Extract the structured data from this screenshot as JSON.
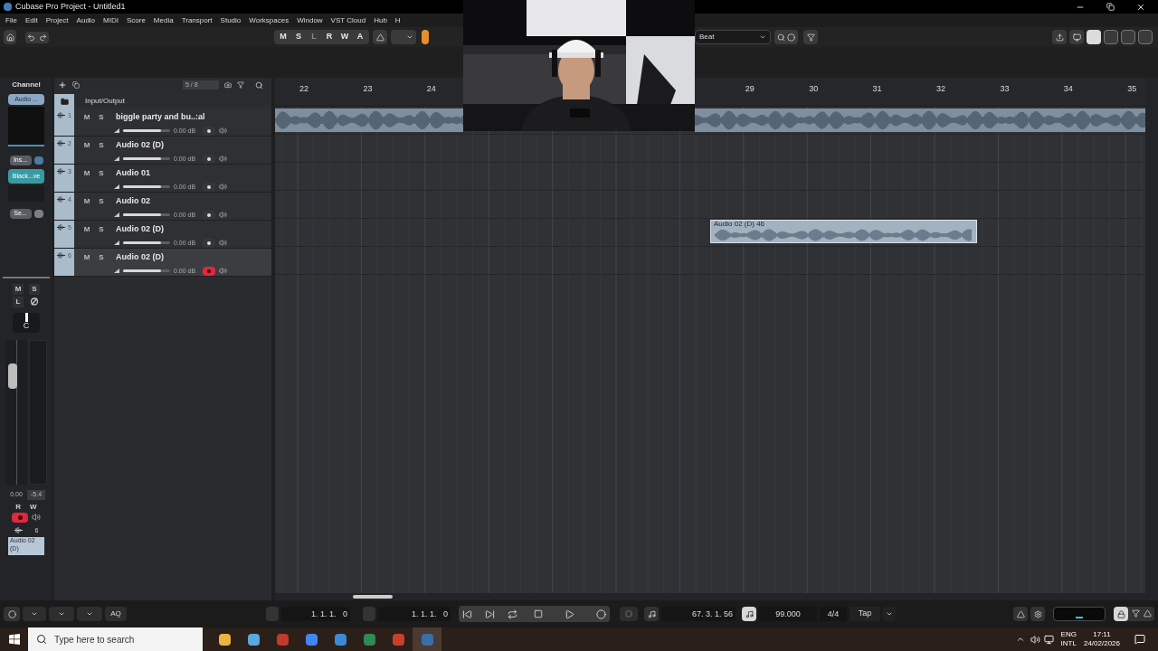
{
  "window": {
    "title": "Cubase Pro Project - Untitled1"
  },
  "menu": [
    "File",
    "Edit",
    "Project",
    "Audio",
    "MIDI",
    "Score",
    "Media",
    "Transport",
    "Studio",
    "Workspaces",
    "Window",
    "VST Cloud",
    "Hub",
    "H"
  ],
  "toolbar": {
    "automation_buttons": [
      {
        "label": "M",
        "disabled": false
      },
      {
        "label": "S",
        "disabled": false
      },
      {
        "label": "L",
        "disabled": true
      },
      {
        "label": "R",
        "disabled": false
      },
      {
        "label": "W",
        "disabled": false
      },
      {
        "label": "A",
        "disabled": false
      }
    ],
    "snap_type": "Beat"
  },
  "inspector": {
    "title": "Channel",
    "track_button": "Audio ...",
    "inserts_button": "Ins...",
    "insert_slot": "Black...ve",
    "sends_button": "Se...",
    "mute": "M",
    "solo": "S",
    "listen": "L",
    "pan": "C",
    "level": 0.8,
    "volume": "0.00",
    "peak": "-5.4",
    "read": "R",
    "write": "W",
    "record": true,
    "track_number": "6",
    "track_name": "Audio 02 (D)"
  },
  "tracklist": {
    "counter": "5 / 8",
    "folder": "Input/Output",
    "tracks": [
      {
        "number": "1",
        "mute": "M",
        "solo": "S",
        "name": "biggle party and bu..:al",
        "volume": "0.00 dB",
        "level": 0.8,
        "record": false,
        "selected": false,
        "events": [
          {
            "kind": "full"
          }
        ]
      },
      {
        "number": "2",
        "mute": "M",
        "solo": "S",
        "name": "Audio 02 (D)",
        "volume": "0.00 dB",
        "level": 0.8,
        "record": false,
        "selected": false
      },
      {
        "number": "3",
        "mute": "M",
        "solo": "S",
        "name": "Audio 01",
        "volume": "0.00 dB",
        "level": 0.8,
        "record": false,
        "selected": false
      },
      {
        "number": "4",
        "mute": "M",
        "solo": "S",
        "name": "Audio 02",
        "volume": "0.00 dB",
        "level": 0.8,
        "record": false,
        "selected": false
      },
      {
        "number": "5",
        "mute": "M",
        "solo": "S",
        "name": "Audio 02 (D)",
        "volume": "0.00 dB",
        "level": 0.8,
        "record": false,
        "selected": false,
        "events": [
          {
            "kind": "clip",
            "name": "Audio 02 (D) 46"
          }
        ]
      },
      {
        "number": "6",
        "mute": "M",
        "solo": "S",
        "name": "Audio 02 (D)",
        "volume": "0.00 dB",
        "level": 0.8,
        "record": true,
        "selected": true
      }
    ]
  },
  "ruler": {
    "before": [
      "22",
      "23",
      "24"
    ],
    "after": [
      "29",
      "30",
      "31",
      "32",
      "33",
      "34",
      "35"
    ]
  },
  "transport": {
    "quantize": "AQ",
    "left_locator": "1. 1. 1.   0",
    "right_locator": "1. 1. 1.   0",
    "position": "67. 3. 1. 56",
    "tempo": "99.000",
    "signature": "4/4",
    "tap": "Tap"
  },
  "taskbar": {
    "search_placeholder": "Type here to search",
    "language": "ENG",
    "layout": "INTL",
    "time": "17:11",
    "date": "24/02/2026"
  }
}
